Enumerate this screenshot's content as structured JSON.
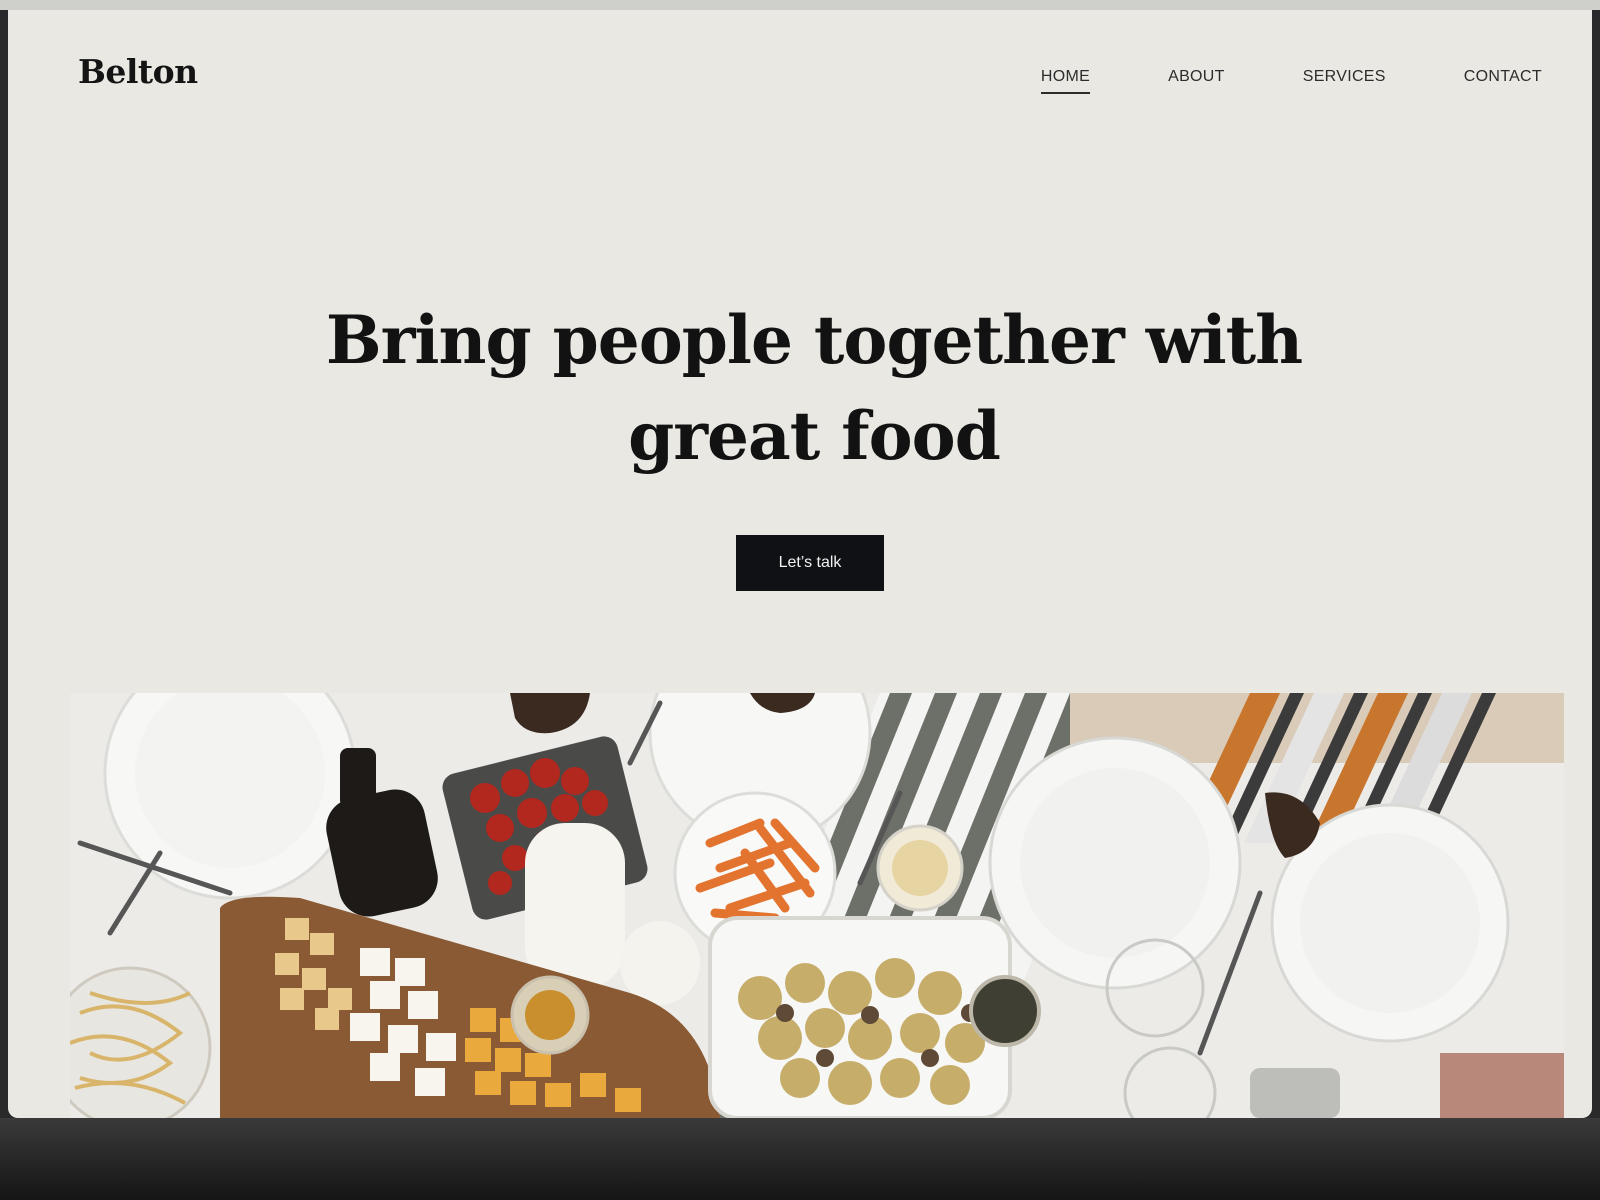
{
  "site": {
    "brand": "Belton"
  },
  "nav": {
    "items": [
      {
        "label": "HOME",
        "active": true
      },
      {
        "label": "ABOUT",
        "active": false
      },
      {
        "label": "SERVICES",
        "active": false
      },
      {
        "label": "CONTACT",
        "active": false
      }
    ]
  },
  "hero": {
    "title_line1": "Bring people together with",
    "title_line2": "great food",
    "cta_label": "Let’s talk"
  },
  "image": {
    "subject": "table-spread-photo"
  },
  "colors": {
    "page_bg": "#e9e8e3",
    "text": "#121212",
    "button_bg": "#101114",
    "button_text": "#f2f2f2"
  }
}
